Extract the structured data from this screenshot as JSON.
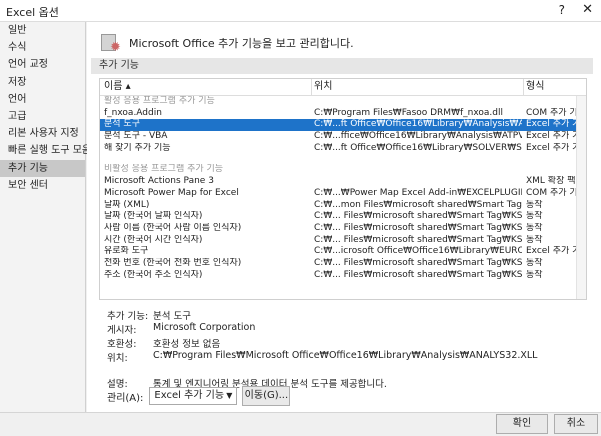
{
  "window": {
    "title": "Excel 옵션",
    "help": "?",
    "close": "✕"
  },
  "sidebar": {
    "items": [
      {
        "label": "일반"
      },
      {
        "label": "수식"
      },
      {
        "label": "언어 교정"
      },
      {
        "label": "저장"
      },
      {
        "label": "언어"
      },
      {
        "label": "고급"
      },
      {
        "label": "리본 사용자 지정"
      },
      {
        "label": "빠른 실행 도구 모음"
      },
      {
        "label": "추가 기능",
        "active": true
      },
      {
        "label": "보안 센터"
      }
    ]
  },
  "header": {
    "icon": "gear-icon",
    "text": "Microsoft Office 추가 기능을 보고 관리합니다."
  },
  "section": {
    "label": "추가 기능"
  },
  "grid": {
    "columns": [
      "이름 ▴",
      "위치",
      "형식"
    ],
    "rows": [
      {
        "kind": "group",
        "name": "활성 응용 프로그램 추가 기능",
        "loc": "",
        "type": ""
      },
      {
        "name": "f_nxoa.Addin",
        "loc": "C:₩Program Files₩Fasoo DRM₩f_nxoa.dll",
        "type": "COM 추가 기능"
      },
      {
        "name": "분석 도구",
        "loc": "C:₩...ft Office₩Office16₩Library₩Analysis₩ANALYS32.XLL",
        "type": "Excel 추가 기능",
        "selected": true
      },
      {
        "name": "분석 도구 - VBA",
        "loc": "C:₩...ffice₩Office16₩Library₩Analysis₩ATPVBAEN.XLAM",
        "type": "Excel 추가 기능"
      },
      {
        "name": "해 찾기 추가 기능",
        "loc": "C:₩...ft Office₩Office16₩Library₩SOLVER₩SOLVER.XLAM",
        "type": "Excel 추가 기능"
      },
      {
        "kind": "spacer",
        "name": "",
        "loc": "",
        "type": ""
      },
      {
        "kind": "group",
        "name": "비활성 응용 프로그램 추가 기능",
        "loc": "",
        "type": ""
      },
      {
        "name": "Microsoft Actions Pane 3",
        "loc": "",
        "type": "XML 확장 팩"
      },
      {
        "name": "Microsoft Power Map for Excel",
        "loc": "C:₩...₩Power Map Excel Add-in₩EXCELPLUGINSHELL.DLL",
        "type": "COM 추가 기능"
      },
      {
        "name": "날짜 (XML)",
        "loc": "C:₩...mon Files₩microsoft shared₩Smart Tag₩MOFL.DLL",
        "type": "동작"
      },
      {
        "name": "날짜 (한국어 날짜 인식자)",
        "loc": "C:₩... Files₩microsoft shared₩Smart Tag₩KSTRECOG.DLL",
        "type": "동작"
      },
      {
        "name": "사람 이름 (한국어 사람 이름 인식자)",
        "loc": "C:₩... Files₩microsoft shared₩Smart Tag₩KSTRECOG.DLL",
        "type": "동작"
      },
      {
        "name": "시간 (한국어 시간 인식자)",
        "loc": "C:₩... Files₩microsoft shared₩Smart Tag₩KSTRECOG.DLL",
        "type": "동작"
      },
      {
        "name": "유로화 도구",
        "loc": "C:₩...icrosoft Office₩Office16₩Library₩EUROTOOL.XLAM",
        "type": "Excel 추가 기능"
      },
      {
        "name": "전화 번호 (한국어 전화 번호 인식자)",
        "loc": "C:₩... Files₩microsoft shared₩Smart Tag₩KSTRECOG.DLL",
        "type": "동작"
      },
      {
        "name": "주소 (한국어 주소 인식자)",
        "loc": "C:₩... Files₩microsoft shared₩Smart Tag₩KSTRECOG.DLL",
        "type": "동작"
      }
    ]
  },
  "details": {
    "addin_label": "추가 기능:",
    "addin_value": "분석 도구",
    "publisher_label": "게시자:",
    "publisher_value": "Microsoft Corporation",
    "compat_label": "호환성:",
    "compat_value": "호환성 정보 없음",
    "location_label": "위치:",
    "location_value": "C:₩Program Files₩Microsoft Office₩Office16₩Library₩Analysis₩ANALYS32.XLL",
    "description_label": "설명:",
    "description_value": "통계 및 엔지니어링 분석용 데이터 분석 도구를 제공합니다."
  },
  "manage": {
    "label": "관리(A):",
    "selected": "Excel 추가 기능",
    "go": "이동(G)..."
  },
  "footer": {
    "ok": "확인",
    "cancel": "취소"
  }
}
